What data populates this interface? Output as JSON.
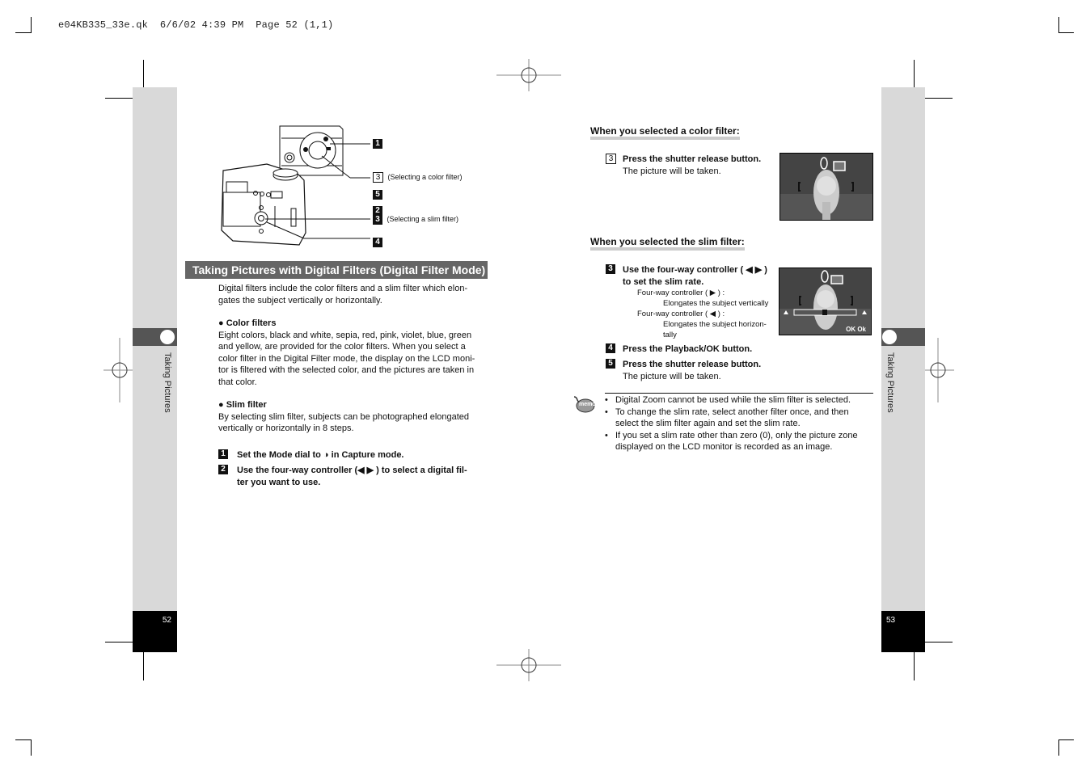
{
  "slug_line": "e04KB335_33e.qk  6/6/02 4:39 PM  Page 52 (1,1)",
  "left_page": {
    "page_number": "52",
    "section_tab": "Taking Pictures",
    "figure_callouts": [
      {
        "num": "1",
        "style": "filled",
        "note": ""
      },
      {
        "num": "3",
        "style": "outline",
        "note": "(Selecting a color filter)"
      },
      {
        "num": "5",
        "style": "filled",
        "note": ""
      },
      {
        "num": "2",
        "style": "filled",
        "note": ""
      },
      {
        "num": "3",
        "style": "filled",
        "note": "(Selecting a slim filter)"
      },
      {
        "num": "4",
        "style": "filled",
        "note": ""
      }
    ],
    "heading": "Taking Pictures with Digital Filters (Digital Filter Mode)",
    "intro": [
      "Digital filters include the color filters and a slim filter which elon-",
      "gates the subject vertically or horizontally."
    ],
    "color_filters": {
      "title": "● Color filters",
      "lines": [
        "Eight colors, black and white, sepia, red, pink, violet, blue, green",
        "and yellow, are provided for the color filters. When you select a",
        "color filter in the Digital Filter mode, the display on the LCD moni-",
        "tor is filtered with the selected color, and the pictures are taken in",
        "that color."
      ]
    },
    "slim_filter": {
      "title": "● Slim filter",
      "lines": [
        "By selecting slim filter, subjects can be photographed elongated",
        "vertically or horizontally in 8 steps."
      ]
    },
    "steps": [
      {
        "num": "1",
        "lines": [
          "Set the Mode dial to ◑  in Capture mode."
        ]
      },
      {
        "num": "2",
        "lines": [
          "Use the four-way controller (◀  ▶ ) to select a digital fil-",
          "ter you want to use."
        ]
      }
    ]
  },
  "right_page": {
    "page_number": "53",
    "section_tab": "Taking Pictures",
    "color_section": {
      "heading": "When you selected a color filter:",
      "step_num": "3",
      "step_title": "Press the shutter release button.",
      "step_text": "The picture will be taken."
    },
    "slim_section": {
      "heading": "When you selected the slim filter:",
      "steps": [
        {
          "num": "3",
          "lines": [
            "Use the four-way controller ( ◀  ▶ )",
            "to set the slim rate."
          ],
          "details": [
            {
              "label": "Four-way controller ( ▶ ) :",
              "desc": [
                "Elongates the subject vertically"
              ]
            },
            {
              "label": "Four-way controller ( ◀ ) :",
              "desc": [
                "Elongates the subject horizon-",
                "tally"
              ]
            }
          ]
        },
        {
          "num": "4",
          "lines": [
            "Press the Playback/OK button."
          ],
          "details": []
        },
        {
          "num": "5",
          "lines": [
            "Press the shutter release button."
          ],
          "text": "The picture will be taken.",
          "details": []
        }
      ],
      "lcd_ok_label": "OK Ok"
    },
    "memo": {
      "icon_label": "memo",
      "items": [
        [
          "Digital Zoom cannot be used while the slim filter is selected."
        ],
        [
          "To change the slim rate, select another filter once, and then",
          "select the slim filter again and set the slim rate."
        ],
        [
          "If you set a slim rate other than zero (0), only the picture zone",
          "displayed on the LCD monitor is recorded as an image."
        ]
      ]
    }
  }
}
